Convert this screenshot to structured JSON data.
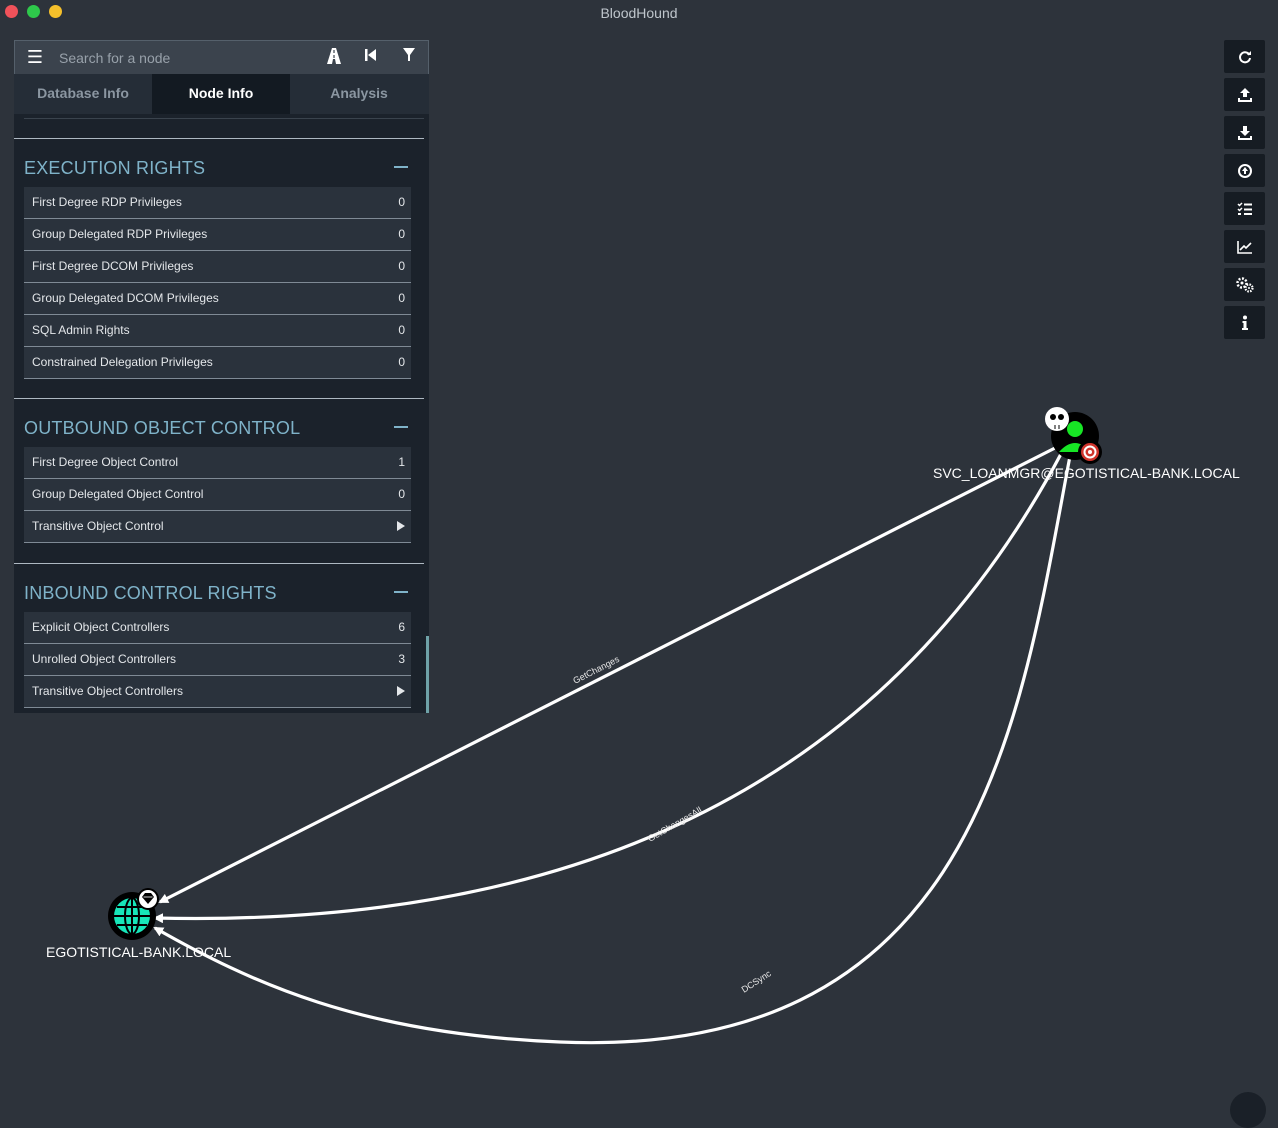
{
  "window": {
    "title": "BloodHound"
  },
  "search": {
    "placeholder": "Search for a node"
  },
  "toolbar_icons": [
    "menu-icon",
    "pathfinding-icon",
    "back-icon",
    "filter-icon"
  ],
  "tabs": [
    {
      "label": "Database Info",
      "active": false
    },
    {
      "label": "Node Info",
      "active": true
    },
    {
      "label": "Analysis",
      "active": false
    }
  ],
  "sections": {
    "execution": {
      "title": "EXECUTION RIGHTS",
      "rows": [
        {
          "label": "First Degree RDP Privileges",
          "value": "0"
        },
        {
          "label": "Group Delegated RDP Privileges",
          "value": "0"
        },
        {
          "label": "First Degree DCOM Privileges",
          "value": "0"
        },
        {
          "label": "Group Delegated DCOM Privileges",
          "value": "0"
        },
        {
          "label": "SQL Admin Rights",
          "value": "0"
        },
        {
          "label": "Constrained Delegation Privileges",
          "value": "0"
        }
      ]
    },
    "outbound": {
      "title": "OUTBOUND OBJECT CONTROL",
      "rows": [
        {
          "label": "First Degree Object Control",
          "value": "1"
        },
        {
          "label": "Group Delegated Object Control",
          "value": "0"
        },
        {
          "label": "Transitive Object Control",
          "value": ""
        }
      ]
    },
    "inbound": {
      "title": "INBOUND CONTROL RIGHTS",
      "rows": [
        {
          "label": "Explicit Object Controllers",
          "value": "6"
        },
        {
          "label": "Unrolled Object Controllers",
          "value": "3"
        },
        {
          "label": "Transitive Object Controllers",
          "value": ""
        }
      ]
    }
  },
  "graph": {
    "nodes": {
      "user": {
        "label": "SVC_LOANMGR@EGOTISTICAL-BANK.LOCAL",
        "type": "user",
        "owned": true,
        "high_value_target": true
      },
      "domain": {
        "label": "EGOTISTICAL-BANK.LOCAL",
        "type": "domain",
        "high_value": true
      }
    },
    "edges": [
      {
        "label": "GetChanges",
        "from": "user",
        "to": "domain"
      },
      {
        "label": "GetChangesAll",
        "from": "user",
        "to": "domain"
      },
      {
        "label": "DCSync",
        "from": "user",
        "to": "domain"
      }
    ]
  },
  "right_toolbar": [
    "refresh-icon",
    "upload-icon",
    "export-icon",
    "import-icon",
    "queries-icon",
    "stats-icon",
    "settings-icon",
    "info-icon"
  ],
  "colors": {
    "background": "#2d333b",
    "panel": "#1b222b",
    "section_title": "#7fb3c9",
    "user_node": "#17e625",
    "domain_node": "#17e6b9",
    "target": "#d0342c"
  }
}
